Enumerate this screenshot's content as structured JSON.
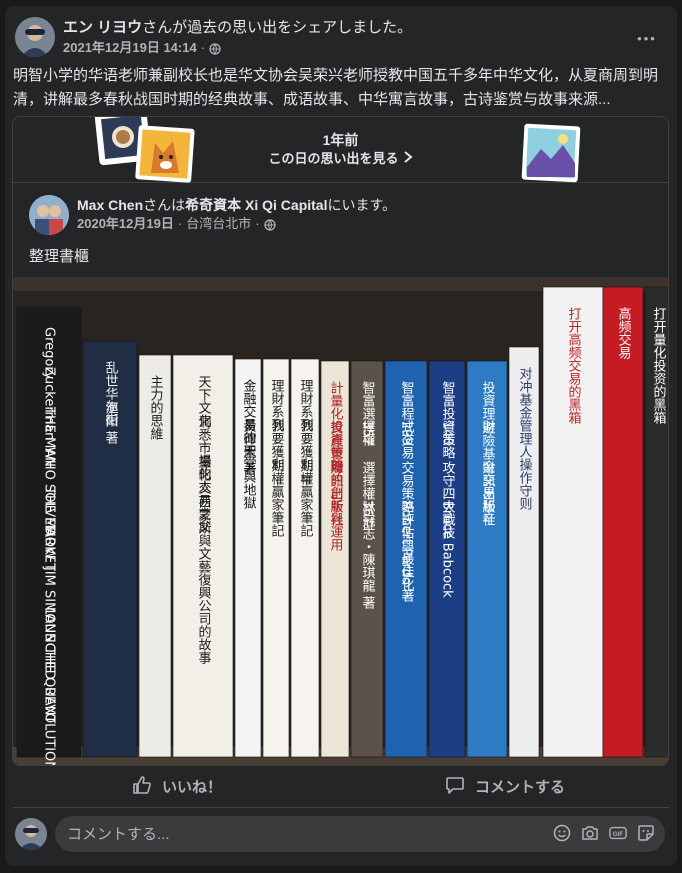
{
  "post": {
    "author": "エン リヨウ",
    "action": "さんが過去の思い出をシェアしました。",
    "date": "2021年12月19日 14:14",
    "separator": "·",
    "more": "•••",
    "text": "明智小学的华语老师兼副校长也是华文协会吴荣兴老师授教中国五千多年中华文化，从夏商周到明清，讲解最多春秋战国时期的经典故事、成语故事、中华寓言故事，古诗鉴赏与故事来源..."
  },
  "memory": {
    "years_ago": "1年前",
    "link_label": "この日の思い出を見る"
  },
  "shared": {
    "author": "Max Chen",
    "connector": "さんは",
    "place": "希奇資本 Xi Qi Capital",
    "suffix": "にいます。",
    "date": "2020年12月19日",
    "location": "台湾台北市",
    "separator": "·",
    "body": "整理書櫃"
  },
  "books": [
    {
      "lines": [
        "Gregory",
        "Zuckerman",
        "THE MAN",
        "WHO SOLVED",
        "THE MARKET",
        "HOW",
        "JIM SIMONS",
        "LAUNCHED",
        "THE QUANT",
        "REVOLUTION"
      ],
      "bg": "#1b1b1b",
      "fg": "#ffffff"
    },
    {
      "lines": [
        "乱世华尔街",
        "渔阳 著"
      ],
      "bg": "#1f2e45",
      "fg": "#f3f3f3"
    },
    {
      "lines": [
        "主力的思維"
      ],
      "bg": "#ecebe5",
      "fg": "#1a1a1a"
    },
    {
      "lines": [
        "天下文化",
        "洞悉市場的人",
        "量化交易之父",
        "西蒙斯與文藝復興公司的故事"
      ],
      "bg": "#f1efe8",
      "fg": "#1a1a1a"
    },
    {
      "lines": [
        "金融交易的天堂與地獄",
        "黃律聖 著"
      ],
      "bg": "#f4f4f4",
      "fg": "#111111"
    },
    {
      "lines": [
        "理財系列",
        "我要獲利",
        "期權贏家筆記"
      ],
      "bg": "#f6f3ee",
      "fg": "#222222"
    },
    {
      "lines": [
        "理財系列",
        "我要獲利 II",
        "期權贏家筆記"
      ],
      "bg": "#f6f3ee",
      "fg": "#222222"
    },
    {
      "lines": [
        "計量化投資策略",
        "資產管理的創新與運用",
        "財訊出版社"
      ],
      "bg": "#ece6d8",
      "fg": "#b32121"
    },
    {
      "lines": [
        "智富選擇權",
        "357",
        "選擇權36計",
        "林冠志・陳琪龍 著"
      ],
      "bg": "#5b5349",
      "fg": "#ffffff"
    },
    {
      "lines": [
        "智富程式交易",
        "299",
        "交易策略評估與最佳化",
        "Robert Pardo 著"
      ],
      "bg": "#1f63b0",
      "fg": "#ffffff"
    },
    {
      "lines": [
        "智富投資策略",
        "140",
        "攻守四大戰技",
        "Bruce Babcock"
      ],
      "bg": "#1c3e85",
      "fg": "#ffffff"
    },
    {
      "lines": [
        "投資理財",
        "避險基金交易秘辛",
        "財訊出版社"
      ],
      "bg": "#2c7bc4",
      "fg": "#ffffff"
    },
    {
      "lines": [
        "对冲基金管理人操作守则"
      ],
      "bg": "#eeeeee",
      "fg": "#2d3a72"
    },
    {
      "lines": [
        "打开高频交易的黑箱"
      ],
      "bg": "#f2f2f2",
      "fg": "#c42024"
    },
    {
      "lines": [
        "高频交易"
      ],
      "bg": "#c51c24",
      "fg": "#ffffff"
    },
    {
      "lines": [
        "打开量化投资的黑箱"
      ],
      "bg": "#2b2b2b",
      "fg": "#ffffff"
    }
  ],
  "actions": {
    "like": "いいね！",
    "comment": "コメントする"
  },
  "composer": {
    "placeholder": "コメントする..."
  }
}
